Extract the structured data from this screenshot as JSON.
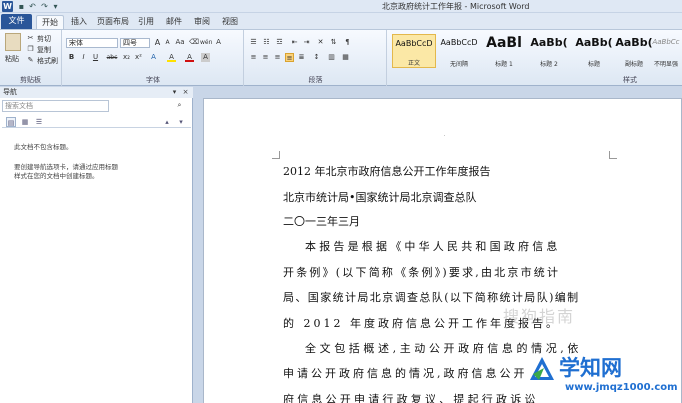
{
  "window": {
    "title": "北京政府统计工作年报 - Microsoft Word"
  },
  "titlebar": {
    "app_icon": "W"
  },
  "tabs": [
    "文件",
    "开始",
    "插入",
    "页面布局",
    "引用",
    "邮件",
    "审阅",
    "视图"
  ],
  "ribbon": {
    "clipboard": {
      "paste": "粘贴",
      "cut": "剪切",
      "copy": "复制",
      "format_painter": "格式刷",
      "label": "剪贴板"
    },
    "font": {
      "name": "宋体",
      "size": "四号",
      "label": "字体",
      "grow": "A",
      "shrink": "A",
      "aa": "Aa",
      "clear": "wén",
      "format_a": "A",
      "bold": "B",
      "italic": "I",
      "underline": "U",
      "strike": "abc",
      "sub": "x₂",
      "sup": "x²",
      "color": "A",
      "highlight": "A",
      "border_a": "A",
      "char": "A"
    },
    "paragraph": {
      "label": "段落"
    },
    "styles": {
      "label": "样式",
      "items": [
        {
          "sample": "AaBbCcD",
          "name": "正文"
        },
        {
          "sample": "AaBbCcD",
          "name": "无间隔"
        },
        {
          "sample": "AaBl",
          "name": "标题 1"
        },
        {
          "sample": "AaBb(",
          "name": "标题 2"
        },
        {
          "sample": "AaBb(",
          "name": "标题"
        },
        {
          "sample": "AaBb(",
          "name": "副标题"
        },
        {
          "sample": "AaBbCc",
          "name": "不明显强"
        }
      ]
    }
  },
  "navpane": {
    "title": "导航",
    "search_placeholder": "搜索文档",
    "msg1": "此文档不包含标题。",
    "msg2": "要创建导航选项卡，请通过应用标题样式在您的文档中创建标题。"
  },
  "document": {
    "line1": "2012 年北京市政府信息公开工作年度报告",
    "line2": "北京市统计局•国家统计局北京调查总队",
    "line3": "二〇一三年三月",
    "p1_1": "本报告是根据《中华人民共和国政府信息",
    "p1_2": "开条例》(以下简称《条例》)要求,由北京市统计",
    "p1_3": "局、国家统计局北京调查总队(以下简称统计局队)编制",
    "p1_4": "的 2012 年度政府信息公开工作年度报告。",
    "p2_1": "全文包括概述,主动公开政府信息的情况,依",
    "p2_2": "申请公开政府信息的情况,政府信息公开",
    "p2_3": "府信息公开申请行政复议、提起行政诉讼",
    "faint": "搜狗指南"
  },
  "site": {
    "name": "学知网",
    "url": "www.jmqz1000.com"
  }
}
